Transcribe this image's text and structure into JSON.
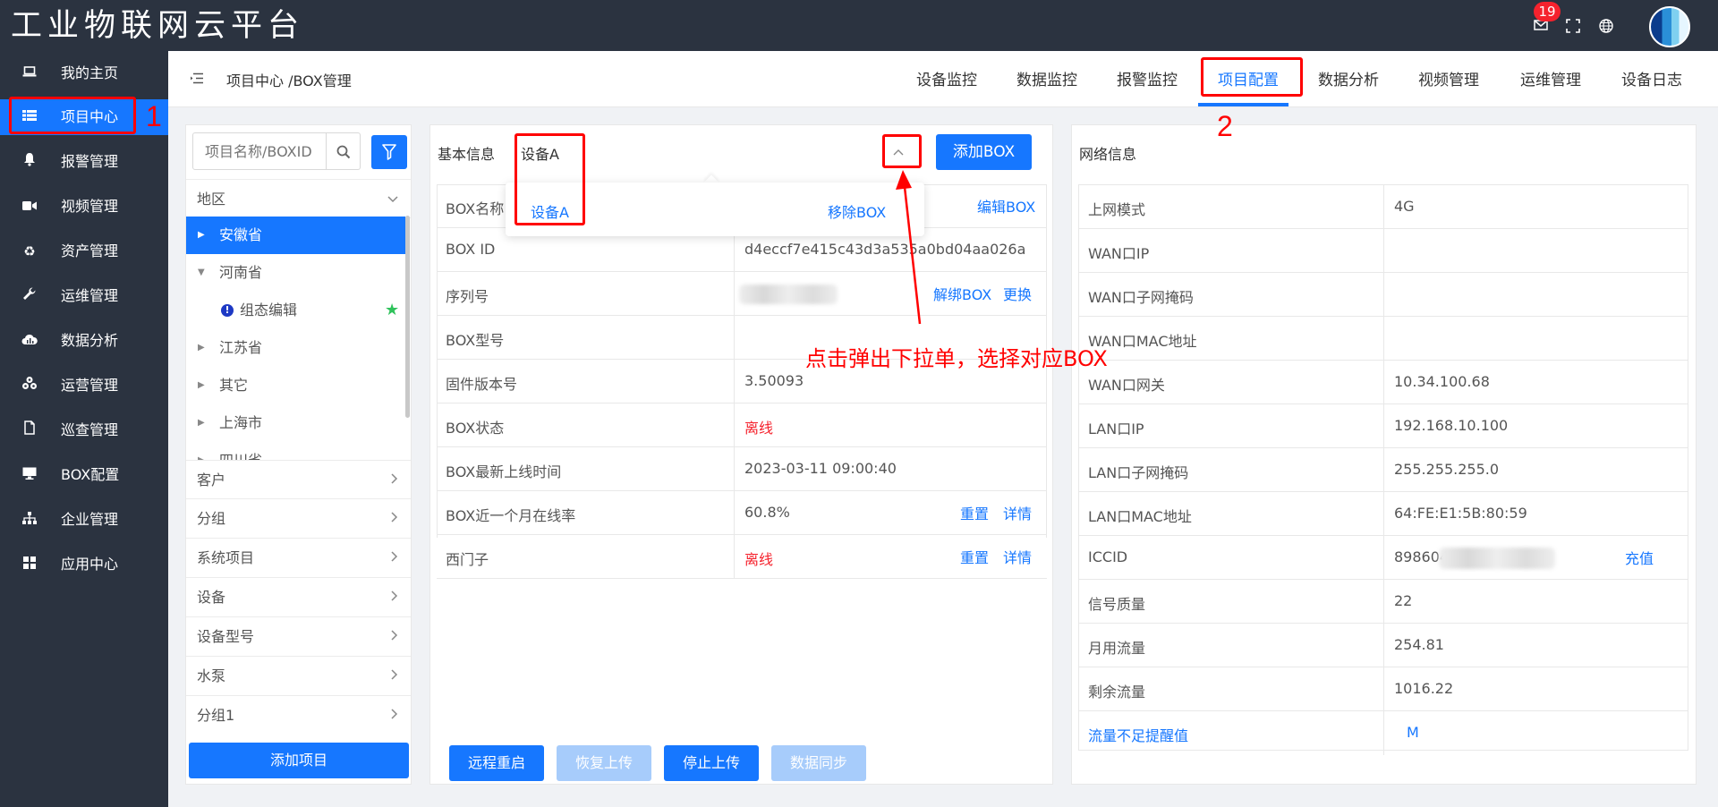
{
  "app": {
    "title": "工业物联网云平台",
    "mail_badge": "19"
  },
  "sidebar": {
    "items": [
      {
        "label": "我的主页",
        "icon": "laptop-icon"
      },
      {
        "label": "项目中心",
        "icon": "list-icon",
        "active": true
      },
      {
        "label": "报警管理",
        "icon": "bell-icon"
      },
      {
        "label": "视频管理",
        "icon": "video-icon"
      },
      {
        "label": "资产管理",
        "icon": "recycle-icon"
      },
      {
        "label": "运维管理",
        "icon": "wrench-icon"
      },
      {
        "label": "数据分析",
        "icon": "chart-cloud-icon"
      },
      {
        "label": "运营管理",
        "icon": "cubes-icon"
      },
      {
        "label": "巡查管理",
        "icon": "file-icon"
      },
      {
        "label": "BOX配置",
        "icon": "monitor-icon"
      },
      {
        "label": "企业管理",
        "icon": "org-icon"
      },
      {
        "label": "应用中心",
        "icon": "grid-icon"
      }
    ]
  },
  "header": {
    "breadcrumb": "项目中心 /BOX管理",
    "tabs": [
      "设备监控",
      "数据监控",
      "报警监控",
      "项目配置",
      "数据分析",
      "视频管理",
      "运维管理",
      "设备日志"
    ],
    "active_tab": "项目配置"
  },
  "left": {
    "search_placeholder": "项目名称/BOXID",
    "region_label": "地区",
    "tree": [
      {
        "label": "安徽省",
        "selected": true
      },
      {
        "label": "河南省",
        "expanded": true
      },
      {
        "label": "组态编辑",
        "child": true
      },
      {
        "label": "江苏省"
      },
      {
        "label": "其它"
      },
      {
        "label": "上海市"
      },
      {
        "label": "四川省"
      }
    ],
    "sections": [
      "客户",
      "分组",
      "系统项目",
      "设备",
      "设备型号",
      "水泵",
      "分组1"
    ],
    "add_button": "添加项目"
  },
  "basic": {
    "label": "基本信息",
    "selected_device": "设备A",
    "add_box": "添加BOX",
    "dropdown": {
      "item": "设备A",
      "remove": "移除BOX"
    },
    "rows": [
      {
        "key": "BOX名称",
        "value": "",
        "actions": [
          "编辑BOX"
        ]
      },
      {
        "key": "BOX ID",
        "value": "d4eccf7e415c43d3a535a0bd04aa026a",
        "actions": []
      },
      {
        "key": "序列号",
        "value": "",
        "actions": [
          "解绑BOX",
          "更换"
        ]
      },
      {
        "key": "BOX型号",
        "value": "",
        "actions": []
      },
      {
        "key": "固件版本号",
        "value": "3.50093",
        "actions": []
      },
      {
        "key": "BOX状态",
        "value": "离线",
        "actions": []
      },
      {
        "key": "BOX最新上线时间",
        "value": "2023-03-11 09:00:40",
        "actions": []
      },
      {
        "key": "BOX近一个月在线率",
        "value": "60.8%",
        "actions": [
          "重置",
          "详情"
        ]
      },
      {
        "key": "西门子",
        "value": "离线",
        "actions": [
          "重置",
          "详情"
        ]
      }
    ],
    "bottom_buttons": [
      "远程重启",
      "恢复上传",
      "停止上传",
      "数据同步"
    ]
  },
  "network": {
    "title": "网络信息",
    "rows": [
      {
        "key": "上网模式",
        "value": "4G"
      },
      {
        "key": "WAN口IP",
        "value": ""
      },
      {
        "key": "WAN口子网掩码",
        "value": ""
      },
      {
        "key": "WAN口MAC地址",
        "value": ""
      },
      {
        "key": "WAN口网关",
        "value": "10.34.100.68"
      },
      {
        "key": "LAN口IP",
        "value": "192.168.10.100"
      },
      {
        "key": "LAN口子网掩码",
        "value": "255.255.255.0"
      },
      {
        "key": "LAN口MAC地址",
        "value": "64:FE:E1:5B:80:59"
      },
      {
        "key": "ICCID",
        "value": "898604",
        "action": "充值"
      },
      {
        "key": "信号质量",
        "value": "22"
      },
      {
        "key": "月用流量",
        "value": "254.81"
      },
      {
        "key": "剩余流量",
        "value": "1016.22"
      },
      {
        "key": "流量不足提醒值",
        "value": "M"
      }
    ]
  },
  "annotations": {
    "n1": "1",
    "n2": "2",
    "text": "点击弹出下拉单，选择对应BOX"
  }
}
